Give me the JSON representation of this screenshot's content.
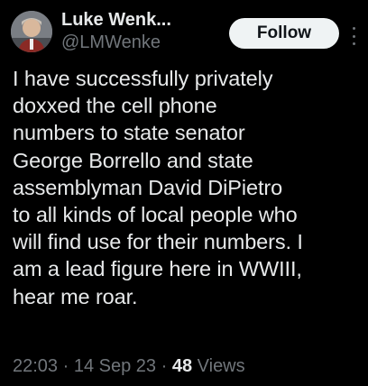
{
  "user": {
    "display_name": "Luke Wenk...",
    "handle": "@LMWenke"
  },
  "follow_button": {
    "label": "Follow"
  },
  "tweet": {
    "text": "I have successfully privately\ndoxxed the cell phone\nnumbers to state senator\nGeorge Borrello and state\nassemblyman David DiPietro\nto all kinds of local people who\nwill find use for their numbers.  I\nam a lead figure here in WWIII,\nhear me roar."
  },
  "meta": {
    "time": "22:03",
    "separator": " · ",
    "date": "14 Sep 23",
    "views_count": "48",
    "views_label": "Views"
  },
  "icons": {
    "avatar": "avatar",
    "more": "more-icon"
  },
  "colors": {
    "background": "#000000",
    "primary_text": "#e7e9ea",
    "secondary_text": "#71767b",
    "button_bg": "#eff3f4"
  }
}
